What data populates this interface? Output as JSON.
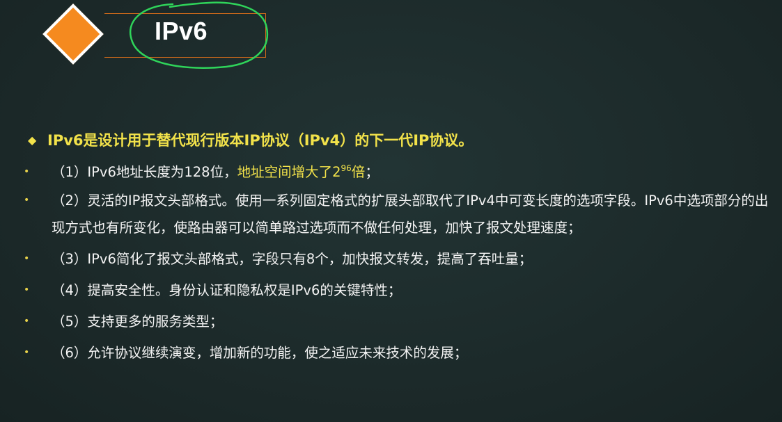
{
  "title": "IPv6",
  "headline": "IPv6是设计用于替代现行版本IP协议（IPv4）的下一代IP协议。",
  "headline_marker": "◆",
  "bullet_marker": "•",
  "colors": {
    "background": "#1d2b2b",
    "accent_orange": "#f58a1f",
    "highlight_yellow": "#f2e24a",
    "ink_green": "#2fd45a"
  },
  "items": [
    {
      "text_before": "（1）IPv6地址长度为128位，",
      "highlight_base": "地址空间增大了2",
      "highlight_exp": "96",
      "highlight_after": "倍",
      "text_after": "；"
    },
    {
      "text": "（2）灵活的IP报文头部格式。使用一系列固定格式的扩展头部取代了IPv4中可变长度的选项字段。IPv6中选项部分的出现方式也有所变化，使路由器可以简单路过选项而不做任何处理，加快了报文处理速度；"
    },
    {
      "text": "（3）IPv6简化了报文头部格式，字段只有8个，加快报文转发，提高了吞吐量；"
    },
    {
      "text": "（4）提高安全性。身份认证和隐私权是IPv6的关键特性；"
    },
    {
      "text": "（5）支持更多的服务类型；"
    },
    {
      "text": "（6）允许协议继续演变，增加新的功能，使之适应未来技术的发展；"
    }
  ]
}
